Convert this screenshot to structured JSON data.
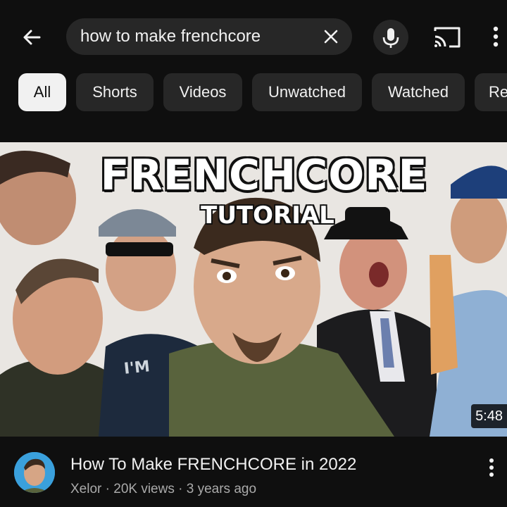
{
  "search": {
    "query": "how to make frenchcore"
  },
  "icons": {
    "back": "arrow-left-icon",
    "clear": "close-icon",
    "mic": "microphone-icon",
    "cast": "cast-icon",
    "more": "more-vert-icon"
  },
  "chips": [
    {
      "label": "All",
      "selected": true
    },
    {
      "label": "Shorts",
      "selected": false
    },
    {
      "label": "Videos",
      "selected": false
    },
    {
      "label": "Unwatched",
      "selected": false
    },
    {
      "label": "Watched",
      "selected": false
    },
    {
      "label": "Re",
      "selected": false
    }
  ],
  "video": {
    "thumbnail_title": "FRENCHCORE",
    "thumbnail_subtitle": "TUTORIAL",
    "thumbnail_shirt_text": "I'M",
    "duration": "5:48",
    "title": "How To Make FRENCHCORE in 2022",
    "channel": "Xelor",
    "views": "20K views",
    "age": "3 years ago",
    "separator": " · "
  },
  "colors": {
    "background": "#0f0f0f",
    "chip_bg": "#272727",
    "chip_selected_bg": "#f1f1f1",
    "text_secondary": "#aaaaaa"
  }
}
